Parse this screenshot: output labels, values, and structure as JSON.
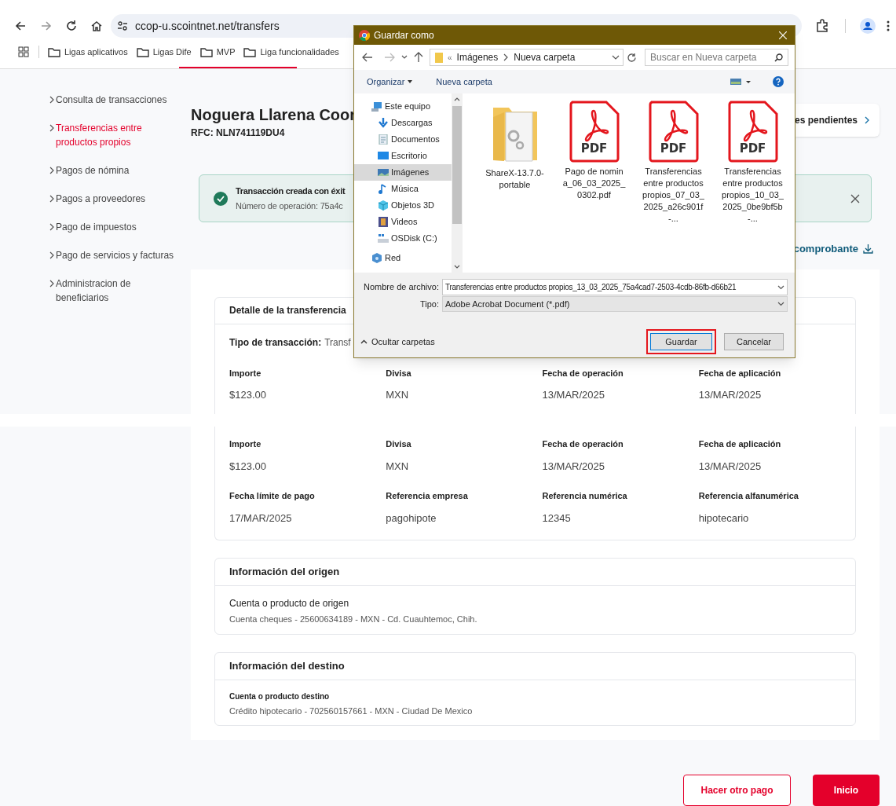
{
  "browser": {
    "url": "ccop-u.scointnet.net/transfers",
    "bookmarks": [
      "Ligas aplicativos",
      "Ligas Dife",
      "MVP",
      "Liga funcionalidades"
    ]
  },
  "top_view": {
    "sidebar": {
      "items": [
        {
          "label": "Consulta de transacciones",
          "selected": false
        },
        {
          "label": "Transferencias entre productos propios",
          "selected": true
        },
        {
          "label": "Pagos de nómina",
          "selected": false
        },
        {
          "label": "Pagos a proveedores",
          "selected": false
        },
        {
          "label": "Pago de impuestos",
          "selected": false
        },
        {
          "label": "Pago de servicios y facturas",
          "selected": false
        },
        {
          "label": "Administracion de beneficiarios",
          "selected": false
        }
      ]
    },
    "header": {
      "name": "Noguera Llarena Coor",
      "rfc": "RFC: NLN741119DU4"
    },
    "pending_button": "es pendientes",
    "alert": {
      "title": "Transacción creada con éxit",
      "operation": "Número de operación: 75a4c"
    },
    "download_link": "comprobante",
    "detail": {
      "title": "Detalle de la transferencia",
      "type_label": "Tipo de transacción:",
      "type_value": "Transf",
      "fields": [
        {
          "label": "Importe",
          "value": "$123.00"
        },
        {
          "label": "Divisa",
          "value": "MXN"
        },
        {
          "label": "Fecha de operación",
          "value": "13/MAR/2025"
        },
        {
          "label": "Fecha de aplicación",
          "value": "13/MAR/2025"
        }
      ]
    }
  },
  "dialog": {
    "title": "Guardar como",
    "breadcrumb_overflow": "«",
    "breadcrumb": [
      "Imágenes",
      "Nueva carpeta"
    ],
    "search_placeholder": "Buscar en Nueva carpeta",
    "organize": "Organizar",
    "new_folder": "Nueva carpeta",
    "tree": [
      {
        "label": "Este equipo",
        "kind": "computer",
        "selected": false
      },
      {
        "label": "Descargas",
        "kind": "download",
        "selected": false
      },
      {
        "label": "Documentos",
        "kind": "document",
        "selected": false
      },
      {
        "label": "Escritorio",
        "kind": "desktop",
        "selected": false
      },
      {
        "label": "Imágenes",
        "kind": "images",
        "selected": true
      },
      {
        "label": "Música",
        "kind": "music",
        "selected": false
      },
      {
        "label": "Objetos 3D",
        "kind": "objects3d",
        "selected": false
      },
      {
        "label": "Videos",
        "kind": "videos",
        "selected": false
      },
      {
        "label": "OSDisk (C:)",
        "kind": "disk",
        "selected": false
      },
      {
        "label": "Red",
        "kind": "network",
        "selected": false
      }
    ],
    "files": [
      {
        "name": "ShareX-13.7.0-portable",
        "kind": "folder"
      },
      {
        "name": "Pago de nomina_06_03_2025_0302.pdf",
        "kind": "pdf",
        "badge": "PDF"
      },
      {
        "name": "Transferencias entre productos propios_07_03_2025_a26c901f-...",
        "kind": "pdf",
        "badge": "PDF"
      },
      {
        "name": "Transferencias entre productos propios_10_03_2025_0be9bf5b-...",
        "kind": "pdf",
        "badge": "PDF"
      }
    ],
    "filename_label": "Nombre de archivo:",
    "filename": "Transferencias entre productos propios_13_03_2025_75a4cad7-2503-4cdb-86fb-d66b21",
    "type_label": "Tipo:",
    "type_value": "Adobe Acrobat Document (*.pdf)",
    "hide_folders": "Ocultar carpetas",
    "save": "Guardar",
    "cancel": "Cancelar"
  },
  "bottom_view": {
    "fields": [
      {
        "label": "Importe",
        "value": "$123.00"
      },
      {
        "label": "Divisa",
        "value": "MXN"
      },
      {
        "label": "Fecha de operación",
        "value": "13/MAR/2025"
      },
      {
        "label": "Fecha de aplicación",
        "value": "13/MAR/2025"
      },
      {
        "label": "Fecha límite de pago",
        "value": "17/MAR/2025"
      },
      {
        "label": "Referencia empresa",
        "value": "pagohipote"
      },
      {
        "label": "Referencia numérica",
        "value": "12345"
      },
      {
        "label": "Referencia alfanumérica",
        "value": "hipotecario"
      }
    ],
    "origin": {
      "title": "Información del origen",
      "label": "Cuenta o producto de origen",
      "value": "Cuenta cheques - 25600634189 - MXN - Cd. Cuauhtemoc, Chih."
    },
    "destination": {
      "title": "Información del destino",
      "label": "Cuenta o producto destino",
      "value": "Crédito hipotecario - 702560157661 - MXN - Ciudad De Mexico"
    },
    "buttons": [
      {
        "label": "Hacer otro pago",
        "kind": "outline"
      },
      {
        "label": "Inicio",
        "kind": "primary"
      }
    ]
  }
}
